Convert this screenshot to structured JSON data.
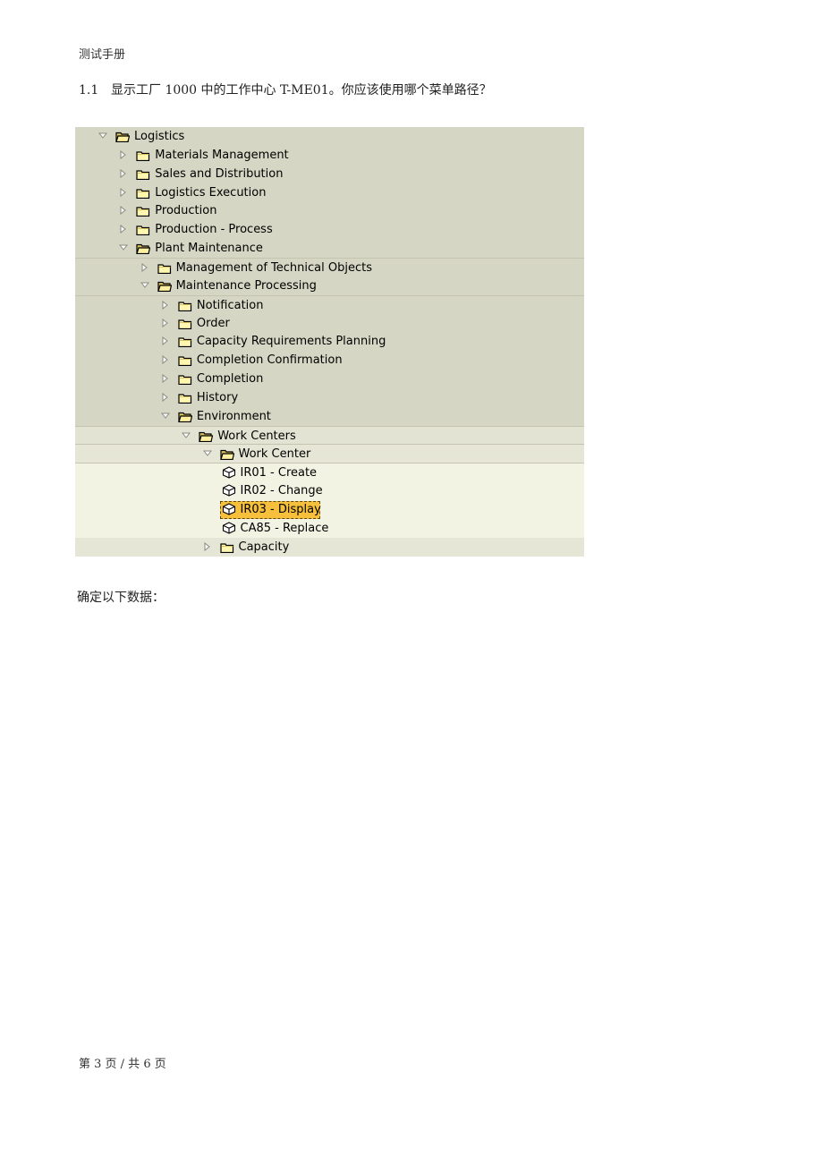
{
  "header": {
    "title": "测试手册"
  },
  "question": {
    "number": "1.1",
    "text": "显示工厂 1000 中的工作中心 T-ME01。你应该使用哪个菜单路径？"
  },
  "tree": {
    "nodes": [
      {
        "label": "Logistics",
        "level": 0,
        "type": "folder",
        "expanded": true
      },
      {
        "label": "Materials Management",
        "level": 1,
        "type": "folder",
        "expanded": false
      },
      {
        "label": "Sales and Distribution",
        "level": 1,
        "type": "folder",
        "expanded": false
      },
      {
        "label": "Logistics Execution",
        "level": 1,
        "type": "folder",
        "expanded": false
      },
      {
        "label": "Production",
        "level": 1,
        "type": "folder",
        "expanded": false
      },
      {
        "label": "Production - Process",
        "level": 1,
        "type": "folder",
        "expanded": false
      },
      {
        "label": "Plant Maintenance",
        "level": 1,
        "type": "folder",
        "expanded": true
      },
      {
        "label": "Management of Technical Objects",
        "level": 2,
        "type": "folder",
        "expanded": false
      },
      {
        "label": "Maintenance Processing",
        "level": 2,
        "type": "folder",
        "expanded": true
      },
      {
        "label": "Notification",
        "level": 3,
        "type": "folder",
        "expanded": false
      },
      {
        "label": "Order",
        "level": 3,
        "type": "folder",
        "expanded": false
      },
      {
        "label": "Capacity Requirements Planning",
        "level": 3,
        "type": "folder",
        "expanded": false
      },
      {
        "label": "Completion Confirmation",
        "level": 3,
        "type": "folder",
        "expanded": false
      },
      {
        "label": "Completion",
        "level": 3,
        "type": "folder",
        "expanded": false
      },
      {
        "label": "History",
        "level": 3,
        "type": "folder",
        "expanded": false
      },
      {
        "label": "Environment",
        "level": 3,
        "type": "folder",
        "expanded": true
      },
      {
        "label": "Work Centers",
        "level": 4,
        "type": "folder",
        "expanded": true
      },
      {
        "label": "Work Center",
        "level": 5,
        "type": "folder",
        "expanded": true
      },
      {
        "label": "IR01 - Create",
        "level": 6,
        "type": "transaction"
      },
      {
        "label": "IR02 - Change",
        "level": 6,
        "type": "transaction"
      },
      {
        "label": "IR03 - Display",
        "level": 6,
        "type": "transaction",
        "selected": true
      },
      {
        "label": "CA85 - Replace",
        "level": 6,
        "type": "transaction"
      },
      {
        "label": "Capacity",
        "level": 5,
        "type": "folder",
        "expanded": false
      }
    ]
  },
  "prompt": {
    "text": "确定以下数据："
  },
  "footer": {
    "page_text": "第 3 页  /  共 6 页"
  },
  "colors": {
    "tree_bg": "#d6d6c4",
    "selected_bg": "#f6bf3c",
    "folder_yellow": "#fff2a0"
  }
}
